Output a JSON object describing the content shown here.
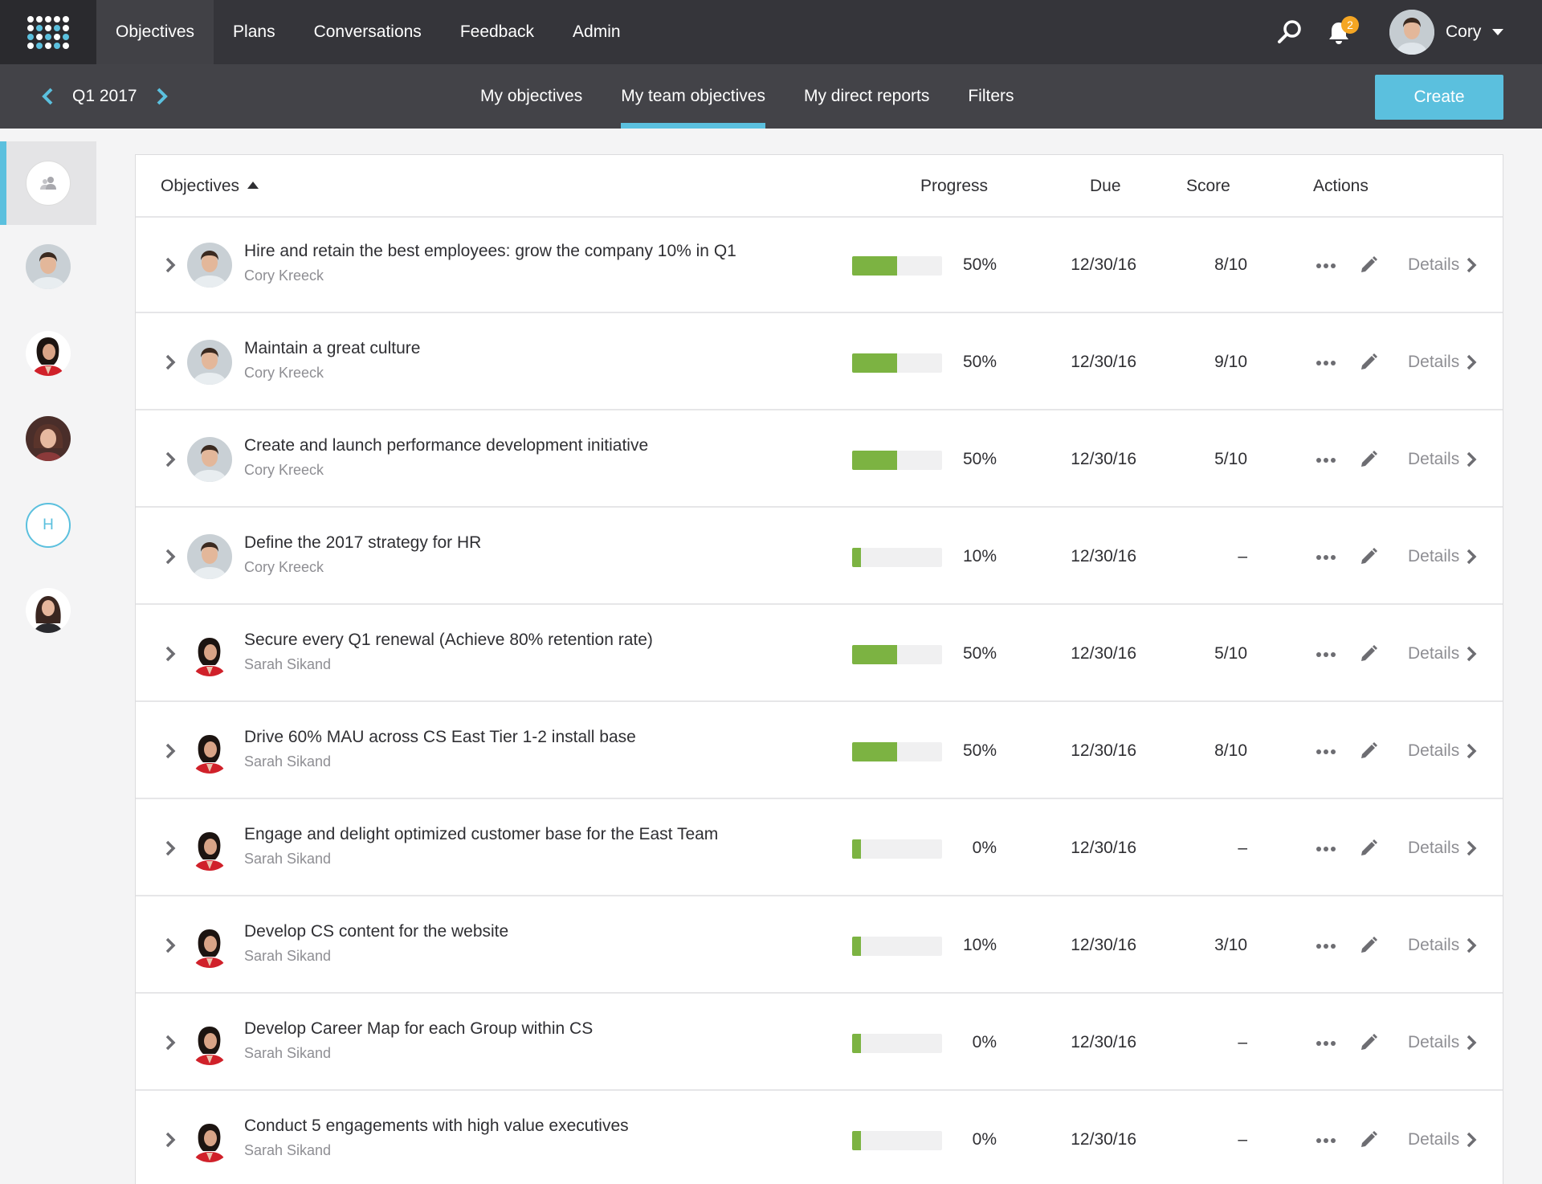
{
  "topbar": {
    "nav": [
      {
        "label": "Objectives",
        "active": true
      },
      {
        "label": "Plans",
        "active": false
      },
      {
        "label": "Conversations",
        "active": false
      },
      {
        "label": "Feedback",
        "active": false
      },
      {
        "label": "Admin",
        "active": false
      }
    ],
    "notification_count": "2",
    "user_name": "Cory",
    "icons": {
      "search": "search-icon",
      "bell": "bell-icon",
      "caret": "caret-down-icon",
      "logo": "app-grid-logo"
    }
  },
  "subbar": {
    "quarter": "Q1 2017",
    "tabs": [
      {
        "label": "My objectives",
        "active": false
      },
      {
        "label": "My team objectives",
        "active": true
      },
      {
        "label": "My direct reports",
        "active": false
      },
      {
        "label": "Filters",
        "active": false
      }
    ],
    "create_label": "Create"
  },
  "rail": {
    "items": [
      {
        "type": "team",
        "icon": "team-icon",
        "active": true
      },
      {
        "type": "avatar",
        "person": "cory"
      },
      {
        "type": "avatar",
        "person": "sarah"
      },
      {
        "type": "avatar",
        "person": "woman2"
      },
      {
        "type": "initial",
        "label": "H"
      },
      {
        "type": "avatar",
        "person": "woman3"
      }
    ]
  },
  "table": {
    "headers": {
      "objectives": "Objectives",
      "progress": "Progress",
      "due": "Due",
      "score": "Score",
      "actions": "Actions"
    },
    "details_label": "Details",
    "rows": [
      {
        "title": "Hire and retain the best employees: grow the company 10% in Q1",
        "owner": "Cory Kreeck",
        "person": "cory",
        "progress": 50,
        "progress_label": "50%",
        "due": "12/30/16",
        "score": "8/10"
      },
      {
        "title": "Maintain a great culture",
        "owner": "Cory Kreeck",
        "person": "cory",
        "progress": 50,
        "progress_label": "50%",
        "due": "12/30/16",
        "score": "9/10"
      },
      {
        "title": "Create and launch performance development initiative",
        "owner": "Cory Kreeck",
        "person": "cory",
        "progress": 50,
        "progress_label": "50%",
        "due": "12/30/16",
        "score": "5/10"
      },
      {
        "title": "Define the 2017 strategy for HR",
        "owner": "Cory Kreeck",
        "person": "cory",
        "progress": 10,
        "progress_label": "10%",
        "due": "12/30/16",
        "score": "–"
      },
      {
        "title": "Secure every Q1 renewal (Achieve 80% retention rate)",
        "owner": "Sarah Sikand",
        "person": "sarah",
        "progress": 50,
        "progress_label": "50%",
        "due": "12/30/16",
        "score": "5/10"
      },
      {
        "title": "Drive 60% MAU across CS East Tier 1-2 install base",
        "owner": "Sarah Sikand",
        "person": "sarah",
        "progress": 50,
        "progress_label": "50%",
        "due": "12/30/16",
        "score": "8/10"
      },
      {
        "title": "Engage and delight optimized customer base for the East Team",
        "owner": "Sarah Sikand",
        "person": "sarah",
        "progress": 10,
        "progress_label": "0%",
        "due": "12/30/16",
        "score": "–"
      },
      {
        "title": "Develop CS content for the website",
        "owner": "Sarah Sikand",
        "person": "sarah",
        "progress": 10,
        "progress_label": "10%",
        "due": "12/30/16",
        "score": "3/10"
      },
      {
        "title": "Develop Career Map for each Group within CS",
        "owner": "Sarah Sikand",
        "person": "sarah",
        "progress": 10,
        "progress_label": "0%",
        "due": "12/30/16",
        "score": "–"
      },
      {
        "title": "Conduct 5 engagements with high value executives",
        "owner": "Sarah Sikand",
        "person": "sarah",
        "progress": 10,
        "progress_label": "0%",
        "due": "12/30/16",
        "score": "–"
      }
    ]
  },
  "colors": {
    "accent": "#5bc0de",
    "progress": "#7cb342",
    "topbar": "#35353a",
    "subbar": "#434348",
    "badge": "#f5a623"
  }
}
